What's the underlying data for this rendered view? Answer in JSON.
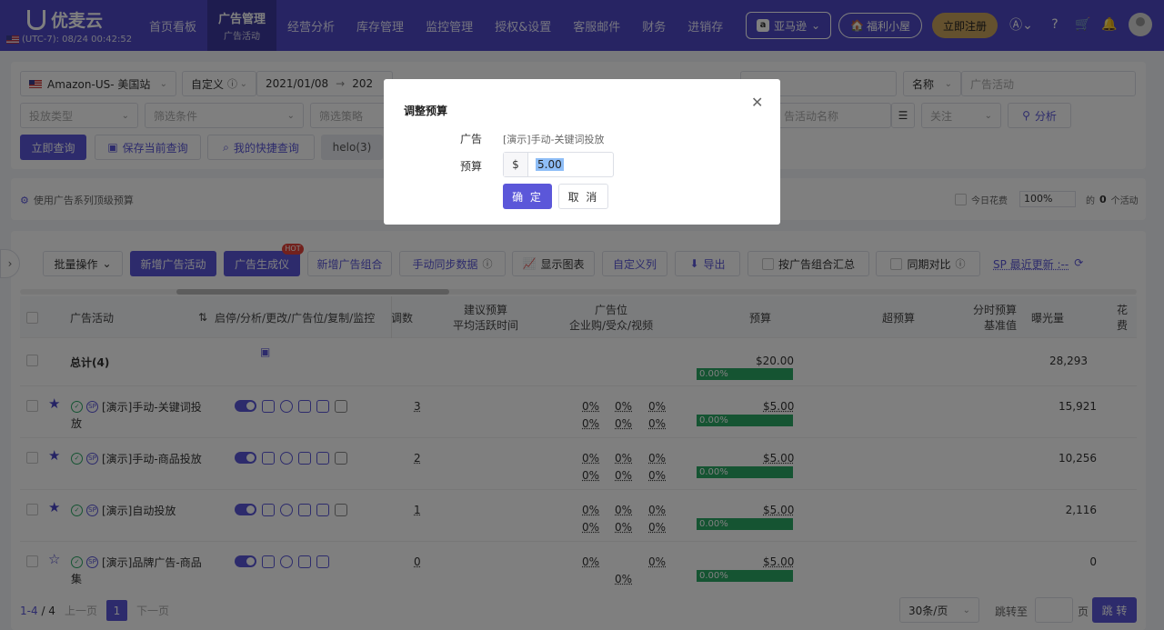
{
  "header": {
    "brand": "优麦云",
    "timezone": "(UTC-7): 08/24 00:42:52",
    "nav": [
      {
        "label": "首页看板"
      },
      {
        "label": "广告管理",
        "sub": "广告活动"
      },
      {
        "label": "经营分析"
      },
      {
        "label": "库存管理"
      },
      {
        "label": "监控管理"
      },
      {
        "label": "授权&设置"
      },
      {
        "label": "客服邮件"
      },
      {
        "label": "财务"
      },
      {
        "label": "进销存"
      }
    ],
    "amazon": "亚马逊",
    "welfare": "福利小屋",
    "register": "立即注册"
  },
  "filters": {
    "site": "Amazon-US- 美国站",
    "date_mode": "自定义",
    "date_start": "2021/01/08",
    "date_end": "202",
    "name_select": "名称",
    "campaign_placeholder": "广告活动",
    "ad_type": "投放类型",
    "filter_cond": "筛选条件",
    "filter_strategy": "筛选策略",
    "campaign_name_ph": "告活动名称",
    "follow": "关注",
    "analyze": "分析",
    "query": "立即查询",
    "save_query": "保存当前查询",
    "my_query": "我的快捷查询",
    "preset": "helo(3)"
  },
  "budget_bar": {
    "label": "使用广告系列顶级预算",
    "today_spend": "今日花费",
    "percent": "100%",
    "of": "的",
    "count": "0",
    "unit": "个活动"
  },
  "toolbar": {
    "batch": "批量操作",
    "new_campaign": "新增广告活动",
    "generator": "广告生成仪",
    "hot": "HOT",
    "new_group": "新增广告组合",
    "sync": "手动同步数据",
    "show_chart": "显示图表",
    "custom_cols": "自定义列",
    "export": "导出",
    "group_summary": "按广告组合汇总",
    "period_compare": "同期对比",
    "sp_update": "SP 最近更新 :--"
  },
  "table": {
    "headers": {
      "campaign": "广告活动",
      "actions": "启停/分析/更改/广告位/复制/监控",
      "count": "调数",
      "suggest1": "建议预算",
      "suggest2": "平均活跃时间",
      "placement1": "广告位",
      "placement2": "企业购/受众/视频",
      "budget": "预算",
      "over": "超预算",
      "time1": "分时预算",
      "time2": "基准值",
      "impressions": "曝光量",
      "spend": "花费"
    },
    "total": {
      "label": "总计(4)",
      "budget": "$20.00",
      "pct": "0.00%",
      "impressions": "28,293"
    },
    "rows": [
      {
        "name1": "[演示]手动-关键词投",
        "name2": "放",
        "count": "3",
        "p1": "0%",
        "p2": "0%",
        "p3": "0%",
        "q1": "0%",
        "q2": "0%",
        "q3": "0%",
        "budget": "$5.00",
        "pct": "0.00%",
        "impressions": "15,921"
      },
      {
        "name1": "[演示]手动-商品投放",
        "name2": "",
        "count": "2",
        "p1": "0%",
        "p2": "0%",
        "p3": "0%",
        "q1": "0%",
        "q2": "0%",
        "q3": "0%",
        "budget": "$5.00",
        "pct": "0.00%",
        "impressions": "10,256"
      },
      {
        "name1": "[演示]自动投放",
        "name2": "",
        "count": "1",
        "p1": "0%",
        "p2": "0%",
        "p3": "0%",
        "q1": "0%",
        "q2": "0%",
        "q3": "0%",
        "budget": "$5.00",
        "pct": "0.00%",
        "impressions": "2,116"
      },
      {
        "name1": "[演示]品牌广告-商品",
        "name2": "集",
        "count": "0",
        "p1": "0%",
        "p2": "",
        "p3": "0%",
        "q1": "",
        "q2": "0%",
        "q3": "",
        "budget": "$5.00",
        "pct": "0.00%",
        "impressions": "0"
      }
    ]
  },
  "pager": {
    "range": "1-4",
    "total": "/ 4",
    "prev": "上一页",
    "page": "1",
    "next": "下一页",
    "size": "30条/页",
    "jump": "跳转至",
    "page_unit": "页",
    "go": "跳 转"
  },
  "modal": {
    "title": "调整预算",
    "ad_label": "广告",
    "ad_value": "[演示]手动-关键词投放",
    "budget_label": "预算",
    "currency": "$",
    "budget_value": "5.00",
    "ok": "确 定",
    "cancel": "取 消"
  }
}
